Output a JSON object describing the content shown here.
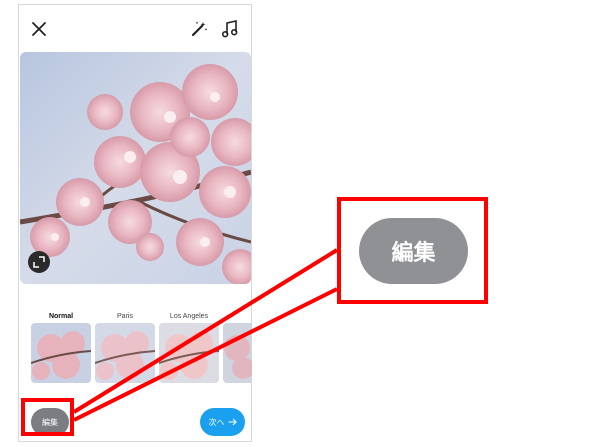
{
  "editor": {
    "filters": [
      {
        "label": "Normal",
        "active": true
      },
      {
        "label": "Paris",
        "active": false
      },
      {
        "label": "Los Angeles",
        "active": false
      }
    ],
    "edit_label": "編集",
    "next_label": "次へ"
  },
  "callout": {
    "label": "編集"
  },
  "colors": {
    "highlight": "#ff0000",
    "next_button": "#1aa0ef",
    "edit_button": "#7b7d82"
  }
}
